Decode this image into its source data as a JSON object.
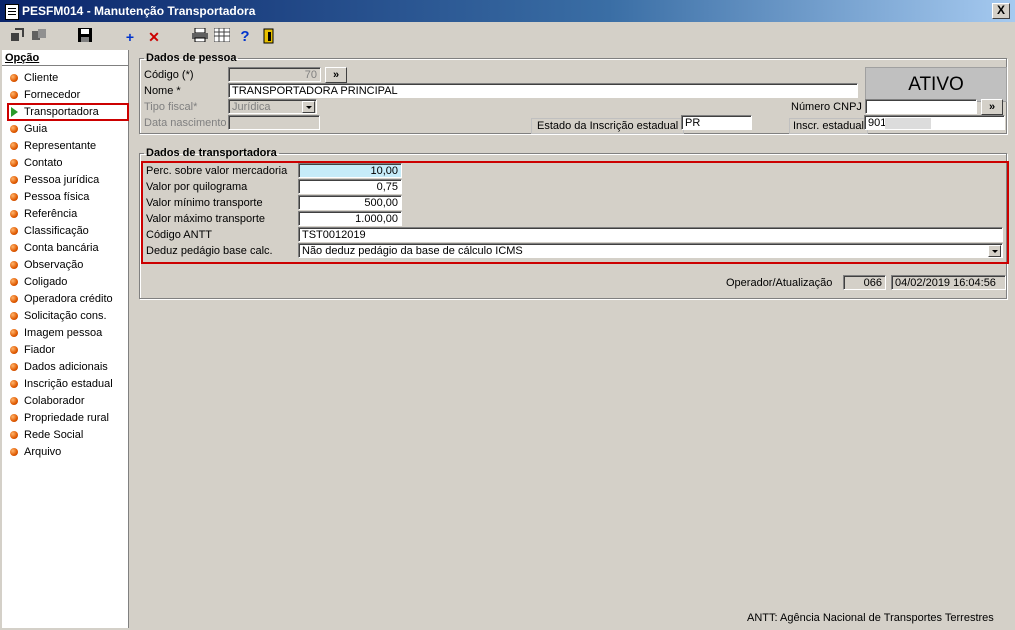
{
  "window": {
    "title": "PESFM014 - Manutenção Transportadora",
    "close_label": "X"
  },
  "toolbar": {
    "icons": [
      "navigate-icon",
      "swap-icon",
      "save-icon",
      "add-icon",
      "delete-icon",
      "print-icon",
      "grid-icon",
      "help-icon",
      "exit-icon"
    ],
    "add_label": "+",
    "delete_label": "✕",
    "help_label": "?"
  },
  "sidebar": {
    "header": "Opção",
    "items": [
      {
        "label": "Cliente"
      },
      {
        "label": "Fornecedor"
      },
      {
        "label": "Transportadora"
      },
      {
        "label": "Guia"
      },
      {
        "label": "Representante"
      },
      {
        "label": "Contato"
      },
      {
        "label": "Pessoa jurídica"
      },
      {
        "label": "Pessoa física"
      },
      {
        "label": "Referência"
      },
      {
        "label": "Classificação"
      },
      {
        "label": "Conta bancária"
      },
      {
        "label": "Observação"
      },
      {
        "label": "Coligado"
      },
      {
        "label": "Operadora crédito"
      },
      {
        "label": "Solicitação cons."
      },
      {
        "label": "Imagem pessoa"
      },
      {
        "label": "Fiador"
      },
      {
        "label": "Dados adicionais"
      },
      {
        "label": "Inscrição estadual"
      },
      {
        "label": "Colaborador"
      },
      {
        "label": "Propriedade rural"
      },
      {
        "label": "Rede Social"
      },
      {
        "label": "Arquivo"
      }
    ],
    "selected": "Transportadora"
  },
  "pessoa": {
    "legend": "Dados de pessoa",
    "codigo_label": "Código (*)",
    "codigo_value": "70",
    "lookup_label": "»",
    "nome_label": "Nome *",
    "nome_value": "TRANSPORTADORA PRINCIPAL",
    "tipo_fiscal_label": "Tipo fiscal*",
    "tipo_fiscal_value": "Jurídica",
    "data_nasc_label": "Data nascimento",
    "estado_ie_label": "Estado da Inscrição estadual",
    "estado_ie_value": "PR",
    "status": "ATIVO",
    "cnpj_label": "Número CNPJ",
    "cnpj_value": "",
    "ie_label": "Inscr. estadual",
    "ie_value": "901"
  },
  "transportadora": {
    "legend": "Dados de transportadora",
    "perc_label": "Perc. sobre valor mercadoria",
    "perc_value": "10,00",
    "quilo_label": "Valor por quilograma",
    "quilo_value": "0,75",
    "min_label": "Valor mínimo transporte",
    "min_value": "500,00",
    "max_label": "Valor máximo transporte",
    "max_value": "1.000,00",
    "antt_label": "Código ANTT",
    "antt_value": "TST0012019",
    "pedagio_label": "Deduz pedágio base calc.",
    "pedagio_value": "Não deduz pedágio da base de cálculo ICMS"
  },
  "operador": {
    "label": "Operador/Atualização",
    "code": "066",
    "datetime": "04/02/2019 16:04:56"
  },
  "footer_note": "ANTT: Agência Nacional de Transportes Terrestres"
}
